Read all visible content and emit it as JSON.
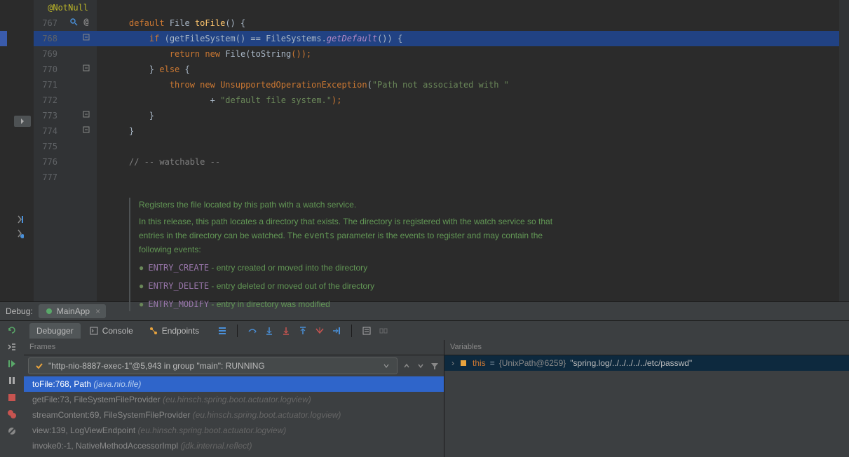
{
  "code": {
    "annotation": "@NotNull",
    "lines": {
      "767": {
        "num": "767"
      },
      "768": {
        "num": "768"
      },
      "769": {
        "num": "769"
      },
      "770": {
        "num": "770"
      },
      "771": {
        "num": "771"
      },
      "772": {
        "num": "772"
      },
      "773": {
        "num": "773"
      },
      "774": {
        "num": "774"
      },
      "775": {
        "num": "775"
      },
      "776": {
        "num": "776"
      },
      "777": {
        "num": "777"
      }
    },
    "tokens": {
      "default": "default",
      "File": "File",
      "toFile": "toFile",
      "if": "if",
      "getFileSystem": "getFileSystem",
      "FileSystems": "FileSystems",
      "getDefault": "getDefault",
      "return": "return",
      "new": "new",
      "FileCtor": "File",
      "toStringCall": "toString",
      "else": "else",
      "throw": "throw",
      "UnsupportedOperationException": "UnsupportedOperationException",
      "str1": "\"Path not associated with \"",
      "plus": "+",
      "str2": "\"default file system.\"",
      "comment": "// -- watchable --"
    },
    "puncParenBrace": "() {",
    "punc": {
      "ifOpen": " (",
      "eq": "() == ",
      "dot": ".",
      "ifClose": "()) {",
      "newFile": "(",
      "toStringEnd": "());",
      "closeBrace": "}",
      "elseBrace": " {",
      "excOpen": "(",
      "excEnd": ");"
    },
    "docs": {
      "line1": "Registers the file located by this path with a watch service.",
      "line2a": "In this release, this path locates a directory that exists. The directory is registered with the watch service so that entries in the directory can be watched. The ",
      "events": "events",
      "line2b": " parameter is the events to register and may contain the following events:",
      "e1": "ENTRY_CREATE",
      "e1d": " - entry created or moved into the directory",
      "e2": "ENTRY_DELETE",
      "e2d": " - entry deleted or moved out of the directory",
      "e3": "ENTRY_MODIFY",
      "e3d": " - entry in directory was modified"
    }
  },
  "debug": {
    "label": "Debug:",
    "runConfig": "MainApp",
    "tabs": {
      "debugger": "Debugger",
      "console": "Console",
      "endpoints": "Endpoints"
    },
    "framesTitle": "Frames",
    "variablesTitle": "Variables",
    "thread": "\"http-nio-8887-exec-1\"@5,943 in group \"main\": RUNNING",
    "frames": [
      {
        "main": "toFile:768, Path ",
        "pkg": "(java.nio.file)"
      },
      {
        "main": "getFile:73, FileSystemFileProvider ",
        "pkg": "(eu.hinsch.spring.boot.actuator.logview)"
      },
      {
        "main": "streamContent:69, FileSystemFileProvider ",
        "pkg": "(eu.hinsch.spring.boot.actuator.logview)"
      },
      {
        "main": "view:139, LogViewEndpoint ",
        "pkg": "(eu.hinsch.spring.boot.actuator.logview)"
      },
      {
        "main": "invoke0:-1, NativeMethodAccessorImpl ",
        "pkg": "(jdk.internal.reflect)"
      }
    ],
    "variable": {
      "name": "this",
      "eq": " = ",
      "type": "{UnixPath@6259}",
      "value": " \"spring.log/../../../../../etc/passwd\""
    }
  }
}
